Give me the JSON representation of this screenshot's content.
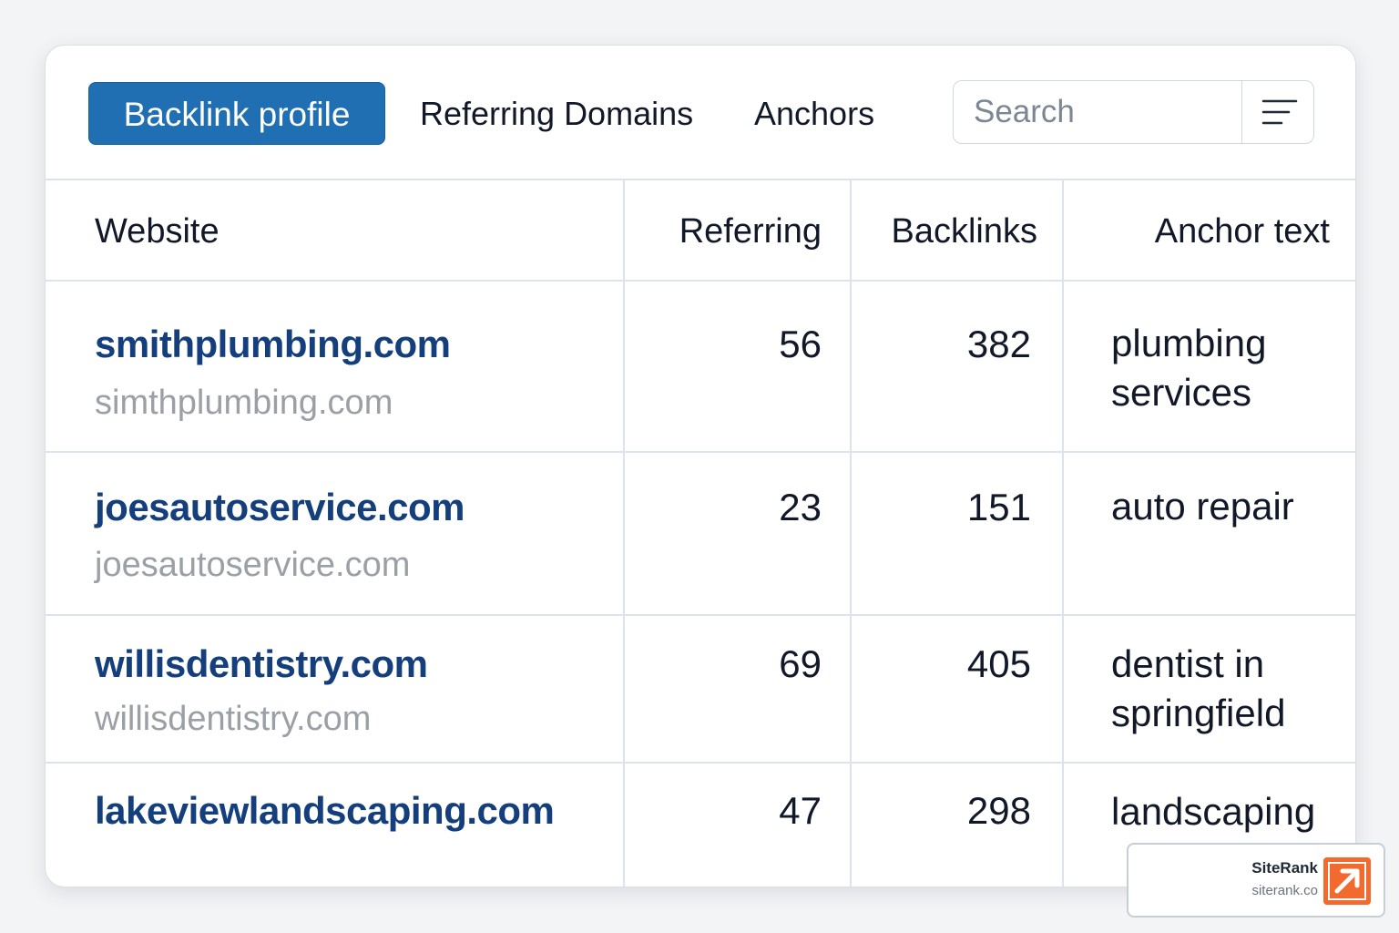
{
  "tabs": {
    "active": "Backlink profile",
    "referring_domains": "Referring Domains",
    "anchors": "Anchors"
  },
  "search": {
    "placeholder": "Search"
  },
  "table": {
    "headers": [
      "Website",
      "Referring",
      "Backlinks",
      "Anchor text"
    ],
    "rows": [
      {
        "site": "smithplumbing.com",
        "sub": "simthplumbing.com",
        "referring": "56",
        "backlinks": "382",
        "anchor": "plumbing services"
      },
      {
        "site": "joesautoservice.com",
        "sub": "joesautoservice.com",
        "referring": "23",
        "backlinks": "151",
        "anchor": "auto repair"
      },
      {
        "site": "willisdentistry.com",
        "sub": "willisdentistry.com",
        "referring": "69",
        "backlinks": "405",
        "anchor": "dentist in springfield"
      },
      {
        "site": "lakeviewlandscaping.com",
        "sub": "",
        "referring": "47",
        "backlinks": "298",
        "anchor": "landscaping"
      }
    ]
  },
  "badge": {
    "name": "SiteRank",
    "url": "siterank.co"
  },
  "colors": {
    "accent": "#1f6fb2",
    "link": "#143f7c",
    "muted": "#9aa0a6",
    "badge": "#f26a2e"
  }
}
